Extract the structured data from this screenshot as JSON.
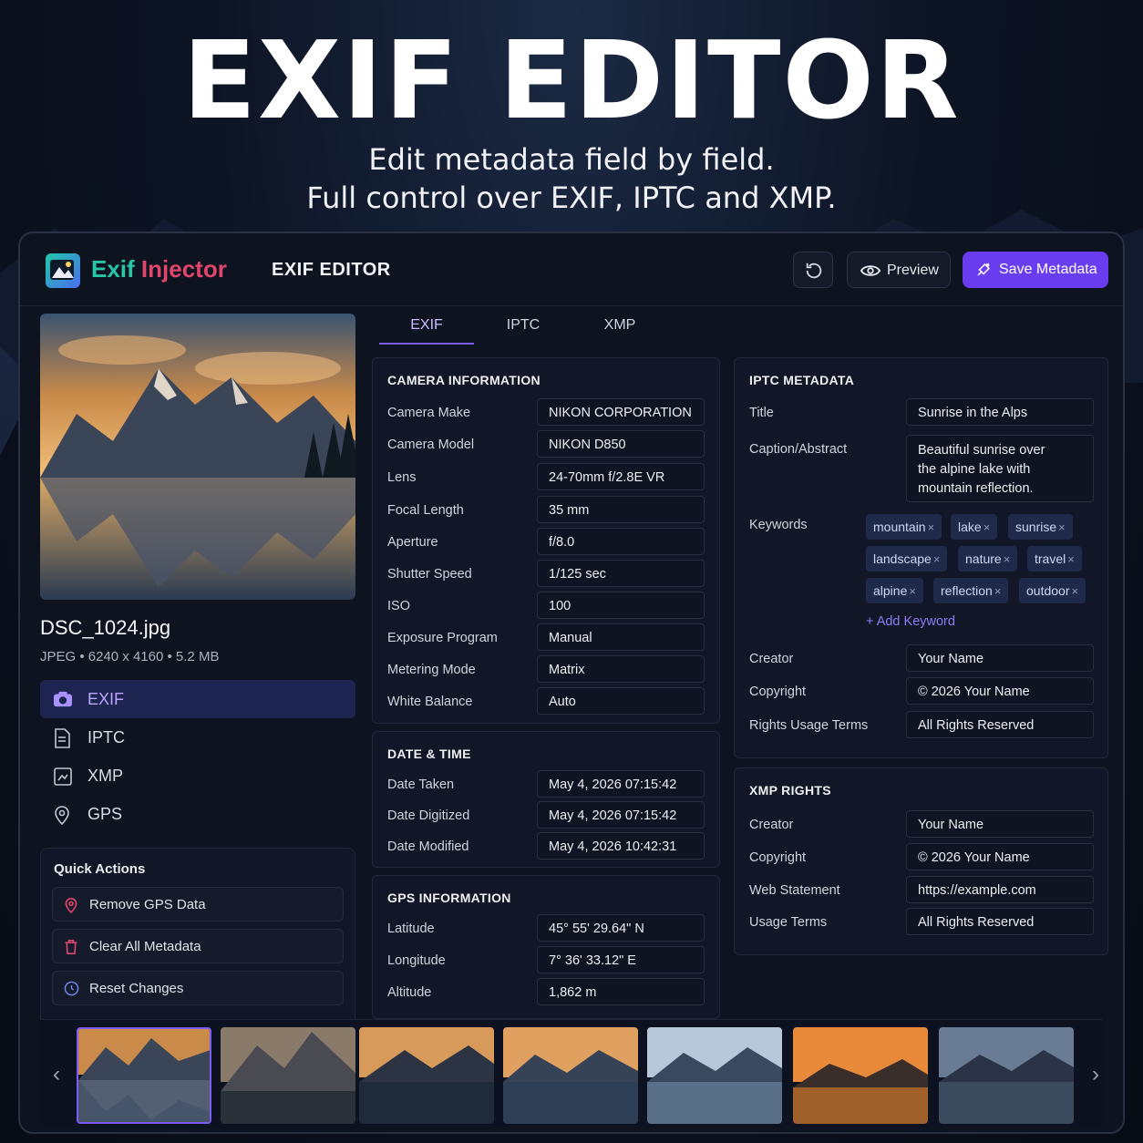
{
  "hero": {
    "title": "EXIF EDITOR",
    "subtitle_line1": "Edit metadata field by field.",
    "subtitle_line2": "Full control over EXIF, IPTC and XMP."
  },
  "header": {
    "logo_part1": "Exif",
    "logo_part2": "Injector",
    "page_title": "EXIF EDITOR",
    "preview_label": "Preview",
    "save_label": "Save Metadata"
  },
  "file": {
    "name": "DSC_1024.jpg",
    "meta": "JPEG • 6240 x 4160 • 5.2 MB"
  },
  "nav": {
    "items": [
      {
        "label": "EXIF",
        "icon": "camera-icon",
        "active": true
      },
      {
        "label": "IPTC",
        "icon": "document-icon",
        "active": false
      },
      {
        "label": "XMP",
        "icon": "xmp-icon",
        "active": false
      },
      {
        "label": "GPS",
        "icon": "map-pin-icon",
        "active": false
      }
    ]
  },
  "quick_actions": {
    "title": "Quick Actions",
    "items": [
      {
        "label": "Remove GPS Data",
        "icon": "map-pin-icon"
      },
      {
        "label": "Clear All Metadata",
        "icon": "trash-icon"
      },
      {
        "label": "Reset Changes",
        "icon": "reset-icon"
      }
    ]
  },
  "tabs": [
    "EXIF",
    "IPTC",
    "XMP"
  ],
  "camera": {
    "title": "CAMERA INFORMATION",
    "rows": [
      {
        "label": "Camera Make",
        "value": "NIKON CORPORATION"
      },
      {
        "label": "Camera Model",
        "value": "NIKON D850"
      },
      {
        "label": "Lens",
        "value": "24-70mm f/2.8E VR"
      },
      {
        "label": "Focal Length",
        "value": "35 mm"
      },
      {
        "label": "Aperture",
        "value": "f/8.0"
      },
      {
        "label": "Shutter Speed",
        "value": "1/125 sec"
      },
      {
        "label": "ISO",
        "value": "100"
      },
      {
        "label": "Exposure Program",
        "value": "Manual"
      },
      {
        "label": "Metering Mode",
        "value": "Matrix"
      },
      {
        "label": "White Balance",
        "value": "Auto"
      }
    ]
  },
  "datetime": {
    "title": "DATE & TIME",
    "rows": [
      {
        "label": "Date Taken",
        "value": "May 4, 2026 07:15:42"
      },
      {
        "label": "Date Digitized",
        "value": "May 4, 2026 07:15:42"
      },
      {
        "label": "Date Modified",
        "value": "May 4, 2026 10:42:31"
      }
    ]
  },
  "gps": {
    "title": "GPS INFORMATION",
    "rows": [
      {
        "label": "Latitude",
        "value": "45° 55' 29.64\" N"
      },
      {
        "label": "Longitude",
        "value": "7° 36' 33.12\" E"
      },
      {
        "label": "Altitude",
        "value": "1,862 m"
      }
    ]
  },
  "iptc": {
    "title": "IPTC METADATA",
    "title_label": "Title",
    "title_value": "Sunrise in the Alps",
    "caption_label": "Caption/Abstract",
    "caption_line1": "Beautiful sunrise over",
    "caption_line2": "the alpine lake with",
    "caption_line3": "mountain reflection.",
    "keywords_label": "Keywords",
    "keywords": [
      "mountain",
      "lake",
      "sunrise",
      "landscape",
      "nature",
      "travel",
      "alpine",
      "reflection",
      "outdoor"
    ],
    "add_keyword": "+ Add Keyword",
    "creator_label": "Creator",
    "creator_value": "Your Name",
    "copyright_label": "Copyright",
    "copyright_value": "© 2026 Your Name",
    "rights_label": "Rights Usage Terms",
    "rights_value": "All Rights Reserved"
  },
  "xmp": {
    "title": "XMP RIGHTS",
    "rows": [
      {
        "label": "Creator",
        "value": "Your Name"
      },
      {
        "label": "Copyright",
        "value": "© 2026 Your Name"
      },
      {
        "label": "Web Statement",
        "value": "https://example.com"
      },
      {
        "label": "Usage Terms",
        "value": "All Rights Reserved"
      }
    ]
  },
  "colors": {
    "accent": "#6a3df0",
    "logo_teal": "#27c6a6",
    "logo_pink": "#e0456c"
  }
}
